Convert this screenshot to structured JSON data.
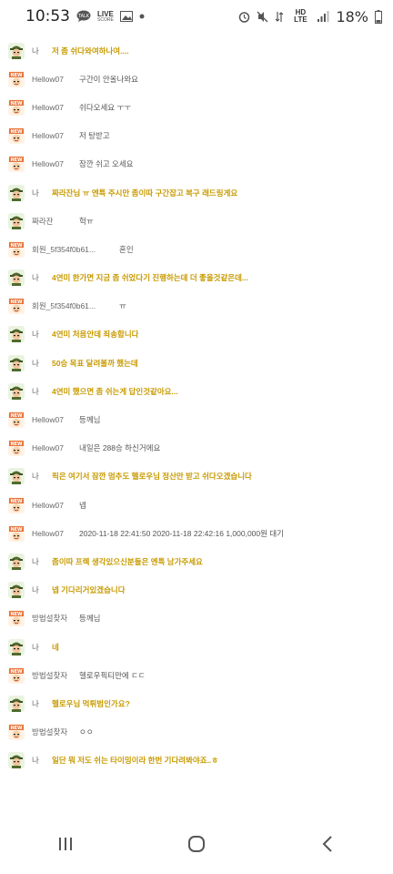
{
  "status_bar": {
    "time": "10:53",
    "live_label": "LIVE",
    "network": "HD LTE",
    "battery": "18%"
  },
  "colors": {
    "my_message": "#c79a00",
    "other_message": "#555555"
  },
  "messages": [
    {
      "sender": "나",
      "text": "저 좀 쉬다와여하나여....",
      "mine": true,
      "avatar": "soldier-icon"
    },
    {
      "sender": "Hellow07",
      "text": "구간이 안올나와요",
      "mine": false,
      "avatar": "new-badge-icon"
    },
    {
      "sender": "Hellow07",
      "text": "쉬다오세요 ㅜㅜ",
      "mine": false,
      "avatar": "new-badge-icon"
    },
    {
      "sender": "Hellow07",
      "text": "저 탕받고",
      "mine": false,
      "avatar": "new-badge-icon"
    },
    {
      "sender": "Hellow07",
      "text": "잠깐 쉬고 오세요",
      "mine": false,
      "avatar": "new-badge-icon"
    },
    {
      "sender": "나",
      "text": "짜라잔님 ㅠ 엔특 주시만 좀이따 구간잡고 복구 래드링게요",
      "mine": true,
      "avatar": "soldier-icon"
    },
    {
      "sender": "짜라잔",
      "text": "헉ㅠ",
      "mine": false,
      "avatar": "soldier-icon"
    },
    {
      "sender": "회원_5f354f0b61...",
      "text": "혼인",
      "mine": false,
      "avatar": "new-badge-icon"
    },
    {
      "sender": "나",
      "text": "4연미 한가면 지금 좀 쉬었다기 진행하는데 더 좋을것같은데...",
      "mine": true,
      "avatar": "soldier-icon"
    },
    {
      "sender": "회원_5f354f0b61...",
      "text": "ㅠ",
      "mine": false,
      "avatar": "new-badge-icon"
    },
    {
      "sender": "나",
      "text": "4연미 처음안데 죄송합니다",
      "mine": true,
      "avatar": "soldier-icon"
    },
    {
      "sender": "나",
      "text": "50승 목표 달려볼까 했는데",
      "mine": true,
      "avatar": "soldier-icon"
    },
    {
      "sender": "나",
      "text": "4연미 했으면 좀 쉬는게 답인것같아요...",
      "mine": true,
      "avatar": "soldier-icon"
    },
    {
      "sender": "Hellow07",
      "text": "등께님",
      "mine": false,
      "avatar": "new-badge-icon"
    },
    {
      "sender": "Hellow07",
      "text": "내일은 288승 하신거에요",
      "mine": false,
      "avatar": "new-badge-icon"
    },
    {
      "sender": "나",
      "text": "픽은 여기서 잠깐 멈추도 헬로우님 정산만 받고 쉬다오겠습니다",
      "mine": true,
      "avatar": "soldier-icon"
    },
    {
      "sender": "Hellow07",
      "text": "넵",
      "mine": false,
      "avatar": "new-badge-icon"
    },
    {
      "sender": "Hellow07",
      "text": "2020-11-18 22:41:50 2020-11-18 22:42:16 1,000,000원 대기",
      "mine": false,
      "avatar": "new-badge-icon"
    },
    {
      "sender": "나",
      "text": "좀이따 프렉 생각있으신분들은 엔특 남가주세요",
      "mine": true,
      "avatar": "soldier-icon"
    },
    {
      "sender": "나",
      "text": "넵 기다리거있겠습니다",
      "mine": true,
      "avatar": "soldier-icon"
    },
    {
      "sender": "방법설찾자",
      "text": "등께님",
      "mine": false,
      "avatar": "new-badge-icon"
    },
    {
      "sender": "나",
      "text": "네",
      "mine": true,
      "avatar": "soldier-icon"
    },
    {
      "sender": "방법설찾자",
      "text": "헬로우픽티만에 ㄷㄷ",
      "mine": false,
      "avatar": "new-badge-icon"
    },
    {
      "sender": "나",
      "text": "헬로우님 먹튀범인가요?",
      "mine": true,
      "avatar": "soldier-icon"
    },
    {
      "sender": "방법설찾자",
      "text": "ㅇㅇ",
      "mine": false,
      "avatar": "new-badge-icon"
    },
    {
      "sender": "나",
      "text": "일단 뭐 저도 쉬는 타이밍이라 한번 기다려봐야죠..ㅎ",
      "mine": true,
      "avatar": "soldier-icon"
    }
  ],
  "nav_bar": {
    "recent_icon": "recent-apps-icon",
    "home_icon": "home-icon",
    "back_icon": "back-icon"
  }
}
